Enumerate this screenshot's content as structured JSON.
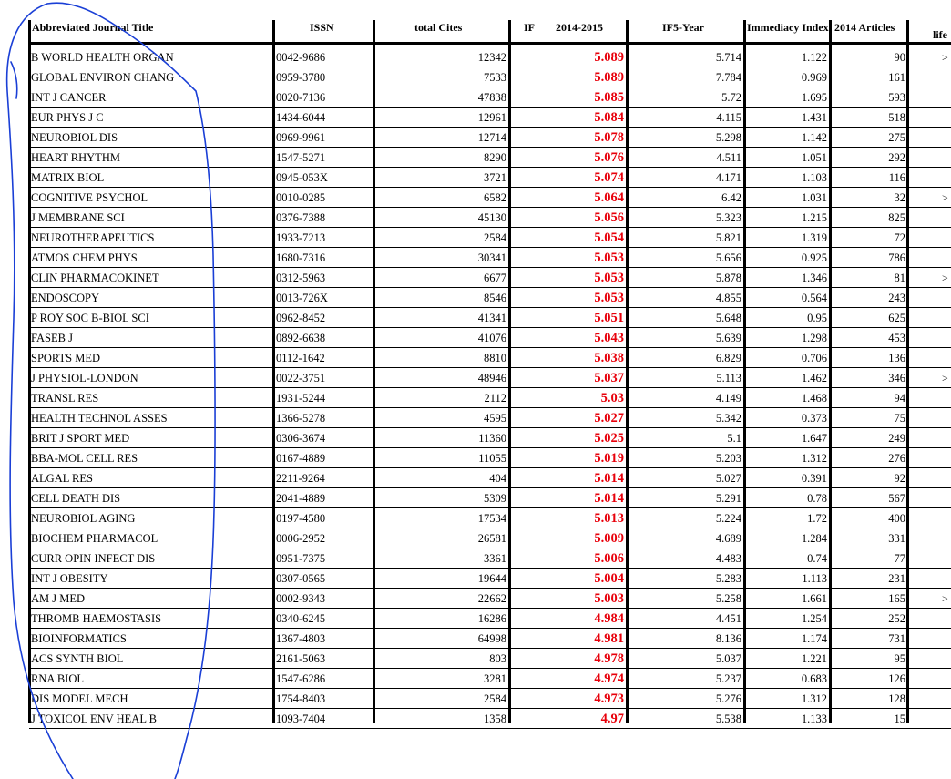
{
  "headers": {
    "title": "Abbreviated Journal Title",
    "issn": "ISSN",
    "cites": "total Cites",
    "if": "IF",
    "period": "2014-2015",
    "if5": "IF5-Year",
    "immediacy": "Immediacy Index",
    "articles": "2014 Articles",
    "life": "life"
  },
  "rows": [
    {
      "title": "B WORLD HEALTH ORGAN",
      "issn": "0042-9686",
      "cites": "12342",
      "if": "5.089",
      "if5": "5.714",
      "imm": "1.122",
      "art": "90",
      "more": ">"
    },
    {
      "title": "GLOBAL ENVIRON CHANG",
      "issn": "0959-3780",
      "cites": "7533",
      "if": "5.089",
      "if5": "7.784",
      "imm": "0.969",
      "art": "161",
      "more": ""
    },
    {
      "title": "INT J CANCER",
      "issn": "0020-7136",
      "cites": "47838",
      "if": "5.085",
      "if5": "5.72",
      "imm": "1.695",
      "art": "593",
      "more": ""
    },
    {
      "title": "EUR PHYS J C",
      "issn": "1434-6044",
      "cites": "12961",
      "if": "5.084",
      "if5": "4.115",
      "imm": "1.431",
      "art": "518",
      "more": ""
    },
    {
      "title": "NEUROBIOL DIS",
      "issn": "0969-9961",
      "cites": "12714",
      "if": "5.078",
      "if5": "5.298",
      "imm": "1.142",
      "art": "275",
      "more": ""
    },
    {
      "title": "HEART RHYTHM",
      "issn": "1547-5271",
      "cites": "8290",
      "if": "5.076",
      "if5": "4.511",
      "imm": "1.051",
      "art": "292",
      "more": ""
    },
    {
      "title": "MATRIX BIOL",
      "issn": "0945-053X",
      "cites": "3721",
      "if": "5.074",
      "if5": "4.171",
      "imm": "1.103",
      "art": "116",
      "more": ""
    },
    {
      "title": "COGNITIVE PSYCHOL",
      "issn": "0010-0285",
      "cites": "6582",
      "if": "5.064",
      "if5": "6.42",
      "imm": "1.031",
      "art": "32",
      "more": ">"
    },
    {
      "title": "J MEMBRANE SCI",
      "issn": "0376-7388",
      "cites": "45130",
      "if": "5.056",
      "if5": "5.323",
      "imm": "1.215",
      "art": "825",
      "more": ""
    },
    {
      "title": "NEUROTHERAPEUTICS",
      "issn": "1933-7213",
      "cites": "2584",
      "if": "5.054",
      "if5": "5.821",
      "imm": "1.319",
      "art": "72",
      "more": ""
    },
    {
      "title": "ATMOS CHEM PHYS",
      "issn": "1680-7316",
      "cites": "30341",
      "if": "5.053",
      "if5": "5.656",
      "imm": "0.925",
      "art": "786",
      "more": ""
    },
    {
      "title": "CLIN PHARMACOKINET",
      "issn": "0312-5963",
      "cites": "6677",
      "if": "5.053",
      "if5": "5.878",
      "imm": "1.346",
      "art": "81",
      "more": ">"
    },
    {
      "title": "ENDOSCOPY",
      "issn": "0013-726X",
      "cites": "8546",
      "if": "5.053",
      "if5": "4.855",
      "imm": "0.564",
      "art": "243",
      "more": ""
    },
    {
      "title": "P ROY SOC B-BIOL SCI",
      "issn": "0962-8452",
      "cites": "41341",
      "if": "5.051",
      "if5": "5.648",
      "imm": "0.95",
      "art": "625",
      "more": ""
    },
    {
      "title": "FASEB J",
      "issn": "0892-6638",
      "cites": "41076",
      "if": "5.043",
      "if5": "5.639",
      "imm": "1.298",
      "art": "453",
      "more": ""
    },
    {
      "title": "SPORTS MED",
      "issn": "0112-1642",
      "cites": "8810",
      "if": "5.038",
      "if5": "6.829",
      "imm": "0.706",
      "art": "136",
      "more": ""
    },
    {
      "title": "J PHYSIOL-LONDON",
      "issn": "0022-3751",
      "cites": "48946",
      "if": "5.037",
      "if5": "5.113",
      "imm": "1.462",
      "art": "346",
      "more": ">"
    },
    {
      "title": "TRANSL RES",
      "issn": "1931-5244",
      "cites": "2112",
      "if": "5.03",
      "if5": "4.149",
      "imm": "1.468",
      "art": "94",
      "more": ""
    },
    {
      "title": "HEALTH TECHNOL ASSES",
      "issn": "1366-5278",
      "cites": "4595",
      "if": "5.027",
      "if5": "5.342",
      "imm": "0.373",
      "art": "75",
      "more": ""
    },
    {
      "title": "BRIT J SPORT MED",
      "issn": "0306-3674",
      "cites": "11360",
      "if": "5.025",
      "if5": "5.1",
      "imm": "1.647",
      "art": "249",
      "more": ""
    },
    {
      "title": "BBA-MOL CELL RES",
      "issn": "0167-4889",
      "cites": "11055",
      "if": "5.019",
      "if5": "5.203",
      "imm": "1.312",
      "art": "276",
      "more": ""
    },
    {
      "title": "ALGAL RES",
      "issn": "2211-9264",
      "cites": "404",
      "if": "5.014",
      "if5": "5.027",
      "imm": "0.391",
      "art": "92",
      "more": ""
    },
    {
      "title": "CELL DEATH DIS",
      "issn": "2041-4889",
      "cites": "5309",
      "if": "5.014",
      "if5": "5.291",
      "imm": "0.78",
      "art": "567",
      "more": ""
    },
    {
      "title": "NEUROBIOL AGING",
      "issn": "0197-4580",
      "cites": "17534",
      "if": "5.013",
      "if5": "5.224",
      "imm": "1.72",
      "art": "400",
      "more": ""
    },
    {
      "title": "BIOCHEM PHARMACOL",
      "issn": "0006-2952",
      "cites": "26581",
      "if": "5.009",
      "if5": "4.689",
      "imm": "1.284",
      "art": "331",
      "more": ""
    },
    {
      "title": "CURR OPIN INFECT DIS",
      "issn": "0951-7375",
      "cites": "3361",
      "if": "5.006",
      "if5": "4.483",
      "imm": "0.74",
      "art": "77",
      "more": ""
    },
    {
      "title": "INT J OBESITY",
      "issn": "0307-0565",
      "cites": "19644",
      "if": "5.004",
      "if5": "5.283",
      "imm": "1.113",
      "art": "231",
      "more": ""
    },
    {
      "title": "AM J MED",
      "issn": "0002-9343",
      "cites": "22662",
      "if": "5.003",
      "if5": "5.258",
      "imm": "1.661",
      "art": "165",
      "more": ">"
    },
    {
      "title": "THROMB HAEMOSTASIS",
      "issn": "0340-6245",
      "cites": "16286",
      "if": "4.984",
      "if5": "4.451",
      "imm": "1.254",
      "art": "252",
      "more": ""
    },
    {
      "title": "BIOINFORMATICS",
      "issn": "1367-4803",
      "cites": "64998",
      "if": "4.981",
      "if5": "8.136",
      "imm": "1.174",
      "art": "731",
      "more": ""
    },
    {
      "title": "ACS SYNTH BIOL",
      "issn": "2161-5063",
      "cites": "803",
      "if": "4.978",
      "if5": "5.037",
      "imm": "1.221",
      "art": "95",
      "more": ""
    },
    {
      "title": "RNA BIOL",
      "issn": "1547-6286",
      "cites": "3281",
      "if": "4.974",
      "if5": "5.237",
      "imm": "0.683",
      "art": "126",
      "more": ""
    },
    {
      "title": "DIS MODEL MECH",
      "issn": "1754-8403",
      "cites": "2584",
      "if": "4.973",
      "if5": "5.276",
      "imm": "1.312",
      "art": "128",
      "more": ""
    },
    {
      "title": "J TOXICOL ENV HEAL B",
      "issn": "1093-7404",
      "cites": "1358",
      "if": "4.97",
      "if5": "5.538",
      "imm": "1.133",
      "art": "15",
      "more": ""
    }
  ],
  "colors": {
    "if_value": "#e8000b",
    "grid": "#000000",
    "doodle": "#1a3fd6"
  }
}
